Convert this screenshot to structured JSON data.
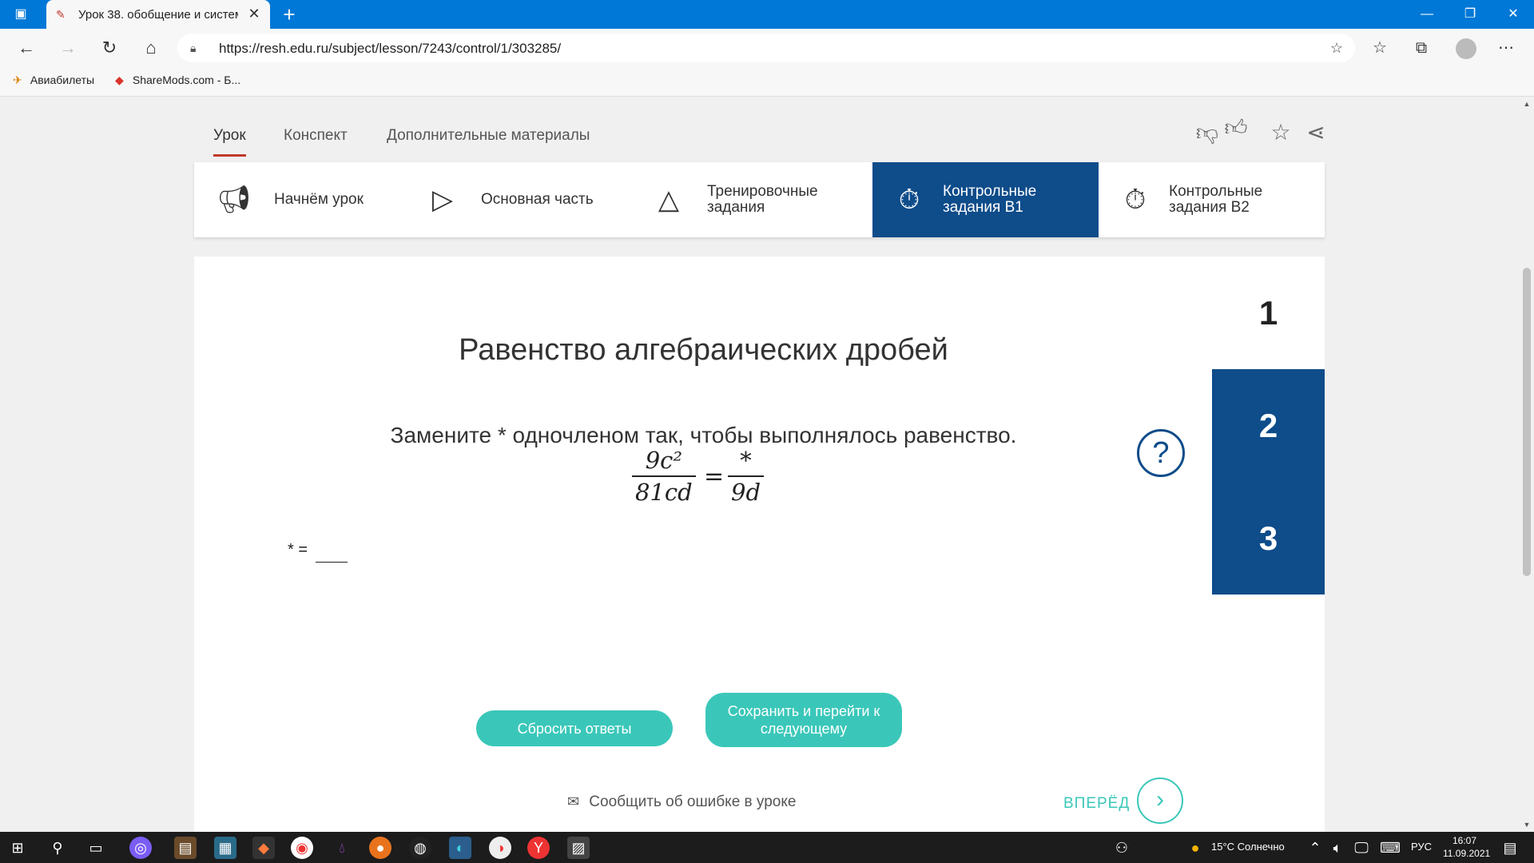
{
  "browser": {
    "tab_title": "Урок 38. обобщение и система",
    "url": "https://resh.edu.ru/subject/lesson/7243/control/1/303285/",
    "bookmarks": [
      "Авиабилеты",
      "ShareMods.com - Б..."
    ]
  },
  "lesson_tabs": [
    "Урок",
    "Конспект",
    "Дополнительные материалы"
  ],
  "steps": [
    {
      "icon": "megaphone-icon",
      "label": "Начнём урок"
    },
    {
      "icon": "play-icon",
      "label": "Основная часть"
    },
    {
      "icon": "pyramid-icon",
      "label": "Тренировочные задания"
    },
    {
      "icon": "stopwatch-icon",
      "label": "Контрольные задания В1"
    },
    {
      "icon": "stopwatch-icon",
      "label": "Контрольные задания В2"
    }
  ],
  "task": {
    "title": "Равенство алгебраических дробей",
    "question": "Замените * одночленом так, чтобы выполнялось равенство.",
    "formula": {
      "left_numerator": "9c²",
      "left_denominator": "81cd",
      "equals": "=",
      "right_numerator": "*",
      "right_denominator": "9d"
    },
    "answer_label": "* =",
    "answer_value": ""
  },
  "task_numbers": [
    "1",
    "2",
    "3"
  ],
  "buttons": {
    "reset": "Сбросить ответы",
    "save_next": "Сохранить и перейти к следующему"
  },
  "report_error": "Сообщить об ошибке в уроке",
  "forward": "ВПЕРЁД",
  "taskbar": {
    "weather": "15°C Солнечно",
    "lang": "РУС",
    "time": "16:07",
    "date": "11.09.2021"
  },
  "colors": {
    "accent_blue": "#0e4c8a",
    "teal": "#3ac7b9",
    "active_tab_underline": "#c0392b",
    "titlebar": "#0078d7"
  }
}
